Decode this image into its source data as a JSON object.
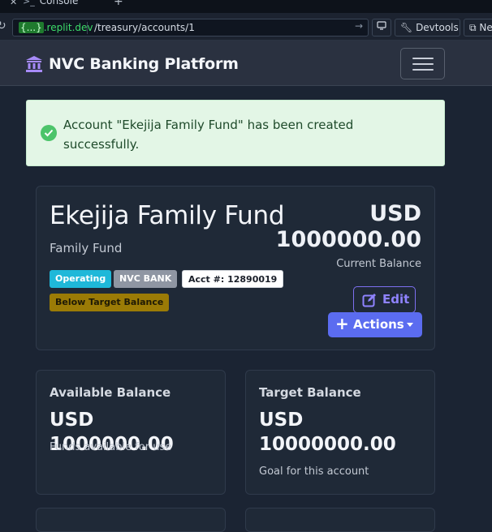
{
  "browser": {
    "tab_title": "Console",
    "url_badge": ".replit.dev",
    "url_badge_braces": "{...}",
    "url_path": "/treasury/accounts/1",
    "devtools_label": "Devtools",
    "newtab_label": "New tab"
  },
  "navbar": {
    "brand": "NVC Banking Platform",
    "brand_color": "#a78bfa"
  },
  "alert": {
    "message": "Account \"Ekejija Family Fund\" has been created successfully."
  },
  "account": {
    "name": "Ekejija Family Fund",
    "type": "Family Fund",
    "badges": {
      "status": "Operating",
      "bank": "NVC BANK",
      "acct": "Acct #: 12890019",
      "warning": "Below Target Balance"
    },
    "balance_currency": "USD",
    "balance_amount": "1000000.00",
    "balance_label": "Current Balance",
    "edit_label": "Edit",
    "actions_label": "Actions"
  },
  "stats": {
    "available": {
      "title": "Available Balance",
      "value": "USD 1000000.00",
      "sub": "Funds available for use"
    },
    "target": {
      "title": "Target Balance",
      "value": "USD 10000000.00",
      "sub": "Goal for this account"
    }
  },
  "colors": {
    "accent": "#5b6cf0",
    "success": "#4cc46a",
    "operating": "#1fb8d9",
    "warning": "#9b7b06"
  }
}
